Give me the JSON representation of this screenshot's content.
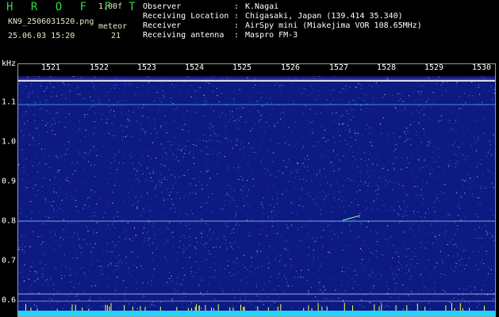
{
  "header": {
    "app_title": "H R O F F T",
    "version": "1.00f",
    "filename": "KN9_2506031520.png",
    "meteor_label": "meteor",
    "datetime": "25.06.03 15:20",
    "meteor_count": "21"
  },
  "info": {
    "rows": [
      {
        "key": "Observer",
        "value": "K.Nagai"
      },
      {
        "key": "Receiving Location",
        "value": "Chigasaki, Japan (139.414 35.340)"
      },
      {
        "key": "Receiver",
        "value": "AirSpy mini (Miakejima VOR 108.65MHz)"
      },
      {
        "key": "Receiving antenna",
        "value": "Maspro FM-3"
      }
    ]
  },
  "axis": {
    "y_unit": "kHz",
    "x_ticks": [
      "1521",
      "1522",
      "1523",
      "1524",
      "1525",
      "1526",
      "1527",
      "1528",
      "1529",
      "1530"
    ],
    "y_ticks": [
      "1.1",
      "1.0",
      "0.9",
      "0.8",
      "0.7",
      "0.6"
    ]
  },
  "colors": {
    "background": "#0d1a82",
    "noise": "#6f86ff",
    "trace_white": "#ffffff",
    "trace_cyan": "#66e0ff",
    "baseline": "#1fd4ff",
    "spike": "#ffff40"
  }
}
